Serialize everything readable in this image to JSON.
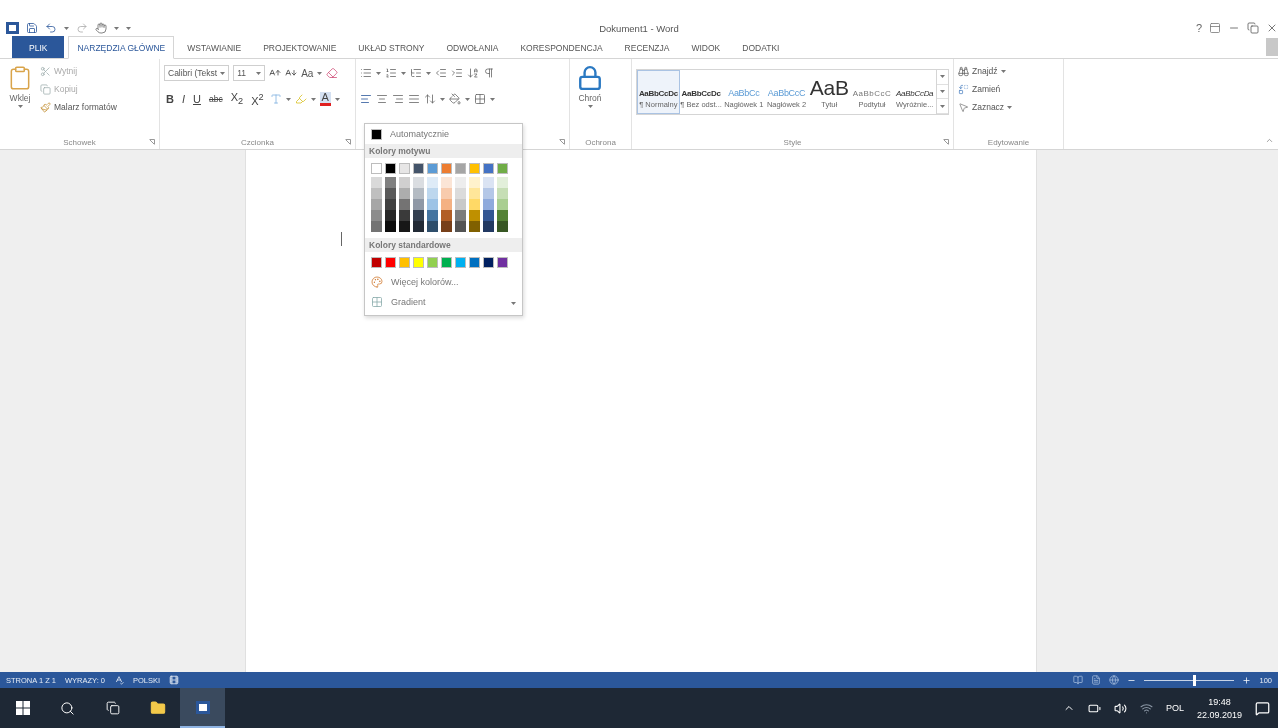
{
  "window": {
    "title": "Dokument1 - Word",
    "help": "?"
  },
  "tabs": [
    {
      "label": "PLIK",
      "kind": "file",
      "selected": false
    },
    {
      "label": "NARZĘDZIA GŁÓWNE",
      "kind": "tab",
      "selected": true
    },
    {
      "label": "WSTAWIANIE",
      "kind": "tab",
      "selected": false
    },
    {
      "label": "PROJEKTOWANIE",
      "kind": "tab",
      "selected": false
    },
    {
      "label": "UKŁAD STRONY",
      "kind": "tab",
      "selected": false
    },
    {
      "label": "ODWOŁANIA",
      "kind": "tab",
      "selected": false
    },
    {
      "label": "KORESPONDENCJA",
      "kind": "tab",
      "selected": false
    },
    {
      "label": "RECENZJA",
      "kind": "tab",
      "selected": false
    },
    {
      "label": "WIDOK",
      "kind": "tab",
      "selected": false
    },
    {
      "label": "DODATKI",
      "kind": "tab",
      "selected": false
    }
  ],
  "clipboard": {
    "paste": "Wklej",
    "cut": "Wytnij",
    "copy": "Kopiuj",
    "painter": "Malarz formatów",
    "group": "Schowek"
  },
  "font": {
    "name": "Calibri (Tekst",
    "size": "11",
    "case": "Aa",
    "color_letter": "A",
    "group": "Czcionka",
    "styles": [
      {
        "text": "B",
        "kind": "bold"
      },
      {
        "text": "I",
        "kind": "italic"
      },
      {
        "text": "U",
        "kind": "underline"
      },
      {
        "text": "abc",
        "kind": "strike"
      },
      {
        "text": "X$_{2}$",
        "kind": "plain"
      },
      {
        "text": "X$^{2}$",
        "kind": "plain"
      }
    ]
  },
  "protect": {
    "label": "Chroń",
    "group": "Ochrona"
  },
  "styles": {
    "group": "Style",
    "items": [
      {
        "preview": "AaBbCcDc",
        "label": "¶ Normalny",
        "kind": "normal",
        "selected": true
      },
      {
        "preview": "AaBbCcDc",
        "label": "¶ Bez odst...",
        "kind": "normal",
        "selected": false
      },
      {
        "preview": "AaBbCc",
        "label": "Nagłówek 1",
        "kind": "heading",
        "selected": false
      },
      {
        "preview": "AaBbCcC",
        "label": "Nagłówek 2",
        "kind": "heading",
        "selected": false
      },
      {
        "preview": "AaB",
        "label": "Tytuł",
        "kind": "title",
        "selected": false
      },
      {
        "preview": "AaBbCcC",
        "label": "Podtytuł",
        "kind": "subtitle",
        "selected": false
      },
      {
        "preview": "AaBbCcDa",
        "label": "Wyróżnie...",
        "kind": "emphasis",
        "selected": false
      }
    ]
  },
  "editing": {
    "find": "Znajdź",
    "replace": "Zamień",
    "select": "Zaznacz",
    "group": "Edytowanie"
  },
  "color_menu": {
    "auto": "Automatycznie",
    "theme_header": "Kolory motywu",
    "theme_colors": [
      {
        "color": "#ffffff"
      },
      {
        "color": "#000000"
      },
      {
        "color": "#e7e6e6"
      },
      {
        "color": "#44546a"
      },
      {
        "color": "#5b9bd5"
      },
      {
        "color": "#ed7d31"
      },
      {
        "color": "#a5a5a5"
      },
      {
        "color": "#ffc000"
      },
      {
        "color": "#4472c4"
      },
      {
        "color": "#70ad47"
      }
    ],
    "standard_header": "Kolory standardowe",
    "standard_colors": [
      {
        "color": "#c00000"
      },
      {
        "color": "#ff0000"
      },
      {
        "color": "#ffc000"
      },
      {
        "color": "#ffff00"
      },
      {
        "color": "#92d050"
      },
      {
        "color": "#00b050"
      },
      {
        "color": "#00b0f0"
      },
      {
        "color": "#0070c0"
      },
      {
        "color": "#002060"
      },
      {
        "color": "#7030a0"
      }
    ],
    "more": "Więcej kolorów...",
    "gradient": "Gradient"
  },
  "status_bar": {
    "items": [
      "STRONA 1 Z 1",
      "WYRAZY: 0",
      "POLSKI"
    ],
    "zoom": {
      "level": 0.55,
      "reading": "100"
    }
  },
  "taskbar": {
    "language": "POL",
    "time": "19:48",
    "date": "22.09.2019"
  }
}
